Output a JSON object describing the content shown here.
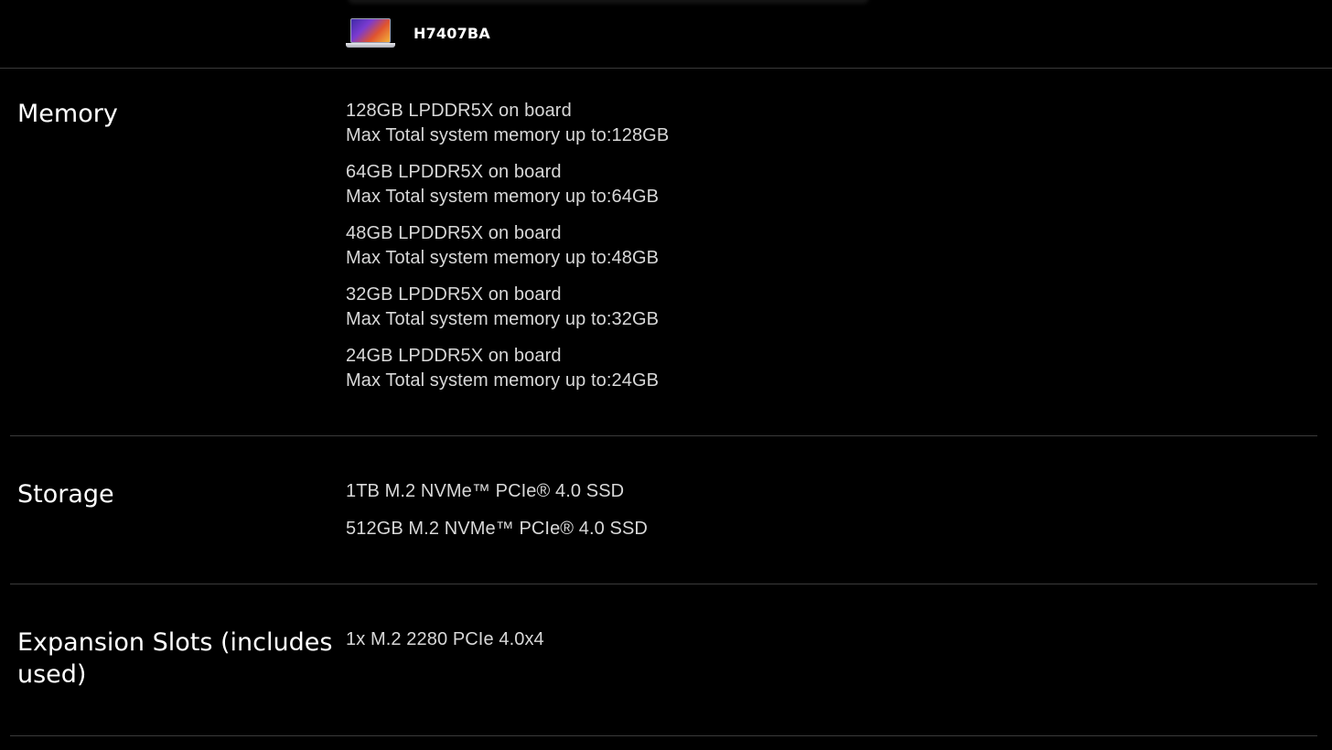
{
  "header": {
    "product_name": "H7407BA",
    "product_icon": "laptop-thumbnail-icon"
  },
  "sections": {
    "memory": {
      "title": "Memory",
      "options": [
        {
          "line1": "128GB LPDDR5X on board",
          "line2": "Max Total system memory up to:128GB"
        },
        {
          "line1": "64GB LPDDR5X on board",
          "line2": "Max Total system memory up to:64GB"
        },
        {
          "line1": "48GB LPDDR5X on board",
          "line2": "Max Total system memory up to:48GB"
        },
        {
          "line1": "32GB LPDDR5X on board",
          "line2": "Max Total system memory up to:32GB"
        },
        {
          "line1": "24GB LPDDR5X on board",
          "line2": "Max Total system memory up to:24GB"
        }
      ]
    },
    "storage": {
      "title": "Storage",
      "options": [
        "1TB M.2 NVMe™ PCIe® 4.0 SSD",
        "512GB M.2 NVMe™ PCIe® 4.0 SSD"
      ]
    },
    "expansion": {
      "title": "Expansion Slots (includes used)",
      "options": [
        "1x M.2 2280 PCIe 4.0x4"
      ]
    }
  },
  "colors": {
    "background": "#000000",
    "text_primary": "#ffffff",
    "text_secondary": "#d8d8d8",
    "divider": "#3a3a3a"
  }
}
